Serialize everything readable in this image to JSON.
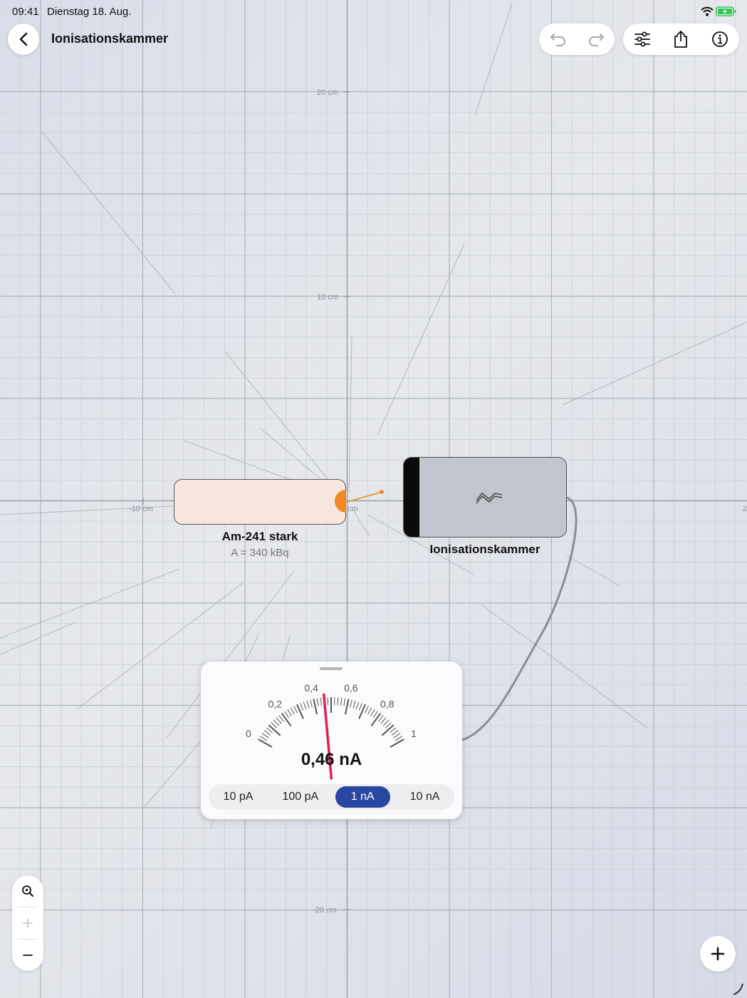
{
  "status_bar": {
    "time": "09:41",
    "date": "Dienstag 18. Aug."
  },
  "header": {
    "title": "Ionisationskammer"
  },
  "toolbar": {
    "icons": [
      "undo-icon",
      "redo-icon",
      "settings-sliders-icon",
      "share-icon",
      "info-icon"
    ]
  },
  "canvas": {
    "axis_labels": {
      "y_top": "20 cm",
      "y_mid": "10 cm",
      "x_left": "-10 cm",
      "x_origin": "cm",
      "x_right": "2",
      "y_bottom": "-20 cm"
    }
  },
  "source": {
    "name": "Am-241 stark",
    "activity": "A = 340 kBq"
  },
  "chamber": {
    "name": "Ionisationskammer"
  },
  "meter": {
    "scale_labels": [
      "0",
      "0,2",
      "0,4",
      "0,6",
      "0,8",
      "1"
    ],
    "needle_value": 0.46,
    "reading": "0,46 nA",
    "ranges": [
      "10 pA",
      "100 pA",
      "1 nA",
      "10 nA"
    ],
    "selected_range": "1 nA"
  },
  "colors": {
    "accent": "#2946a0",
    "source_fill": "#f6e6dc",
    "source_port": "#f08a24",
    "needle": "#e0204a",
    "battery": "#35c759"
  }
}
